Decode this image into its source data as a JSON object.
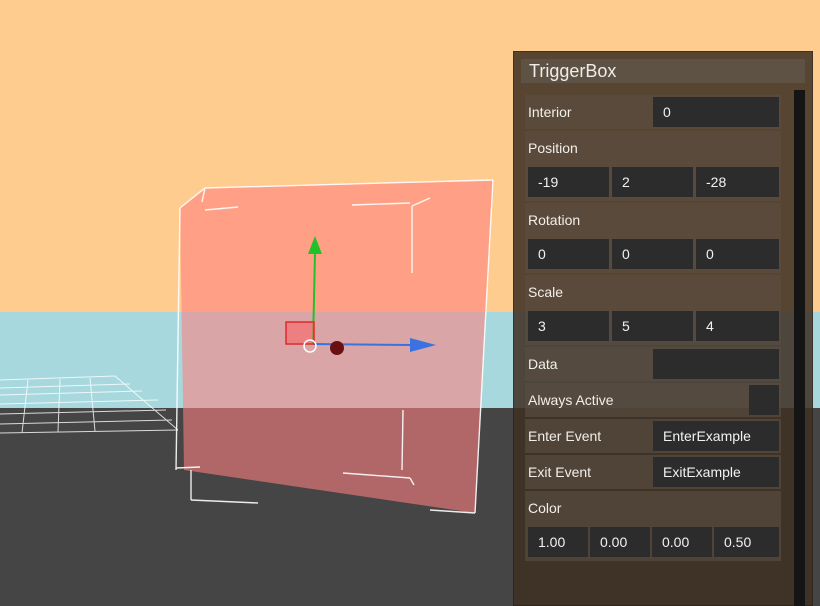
{
  "panel": {
    "title": "TriggerBox",
    "interior": {
      "label": "Interior",
      "value": "0"
    },
    "position": {
      "label": "Position",
      "x": "-19",
      "y": "2",
      "z": "-28"
    },
    "rotation": {
      "label": "Rotation",
      "x": "0",
      "y": "0",
      "z": "0"
    },
    "scale": {
      "label": "Scale",
      "x": "3",
      "y": "5",
      "z": "4"
    },
    "data": {
      "label": "Data",
      "value": ""
    },
    "always_active": {
      "label": "Always Active",
      "checked": false
    },
    "enter_event": {
      "label": "Enter Event",
      "value": "EnterExample"
    },
    "exit_event": {
      "label": "Exit Event",
      "value": "ExitExample"
    },
    "color": {
      "label": "Color",
      "r": "1.00",
      "g": "0.00",
      "b": "0.00",
      "a": "0.50"
    }
  },
  "colors": {
    "sky": "#ffcc8f",
    "water": "#a7d8de",
    "ground": "#454545",
    "trigger_box": "#ff8080",
    "gizmo_x": "#3a73e0",
    "gizmo_y": "#22c02a",
    "gizmo_z": "#e02a2a"
  },
  "icons": [
    "move-gizmo-icon",
    "arrow-x-icon",
    "arrow-y-icon",
    "rotate-handle-icon"
  ]
}
